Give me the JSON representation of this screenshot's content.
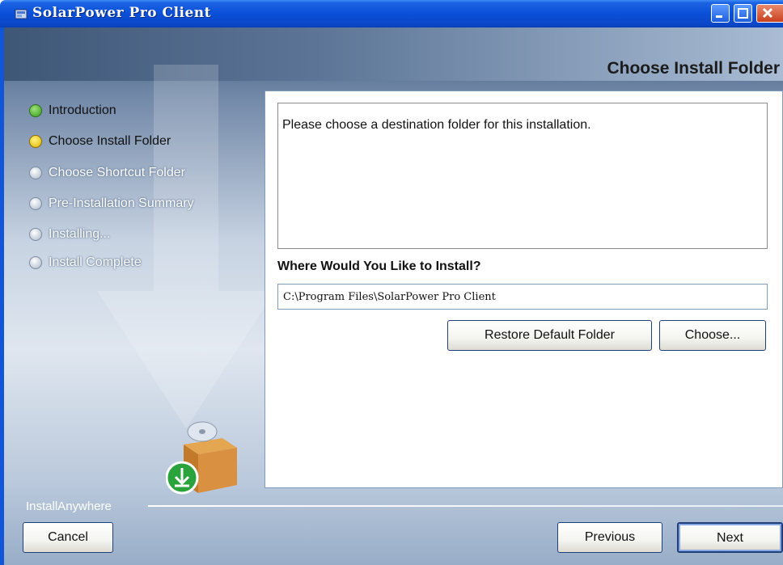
{
  "window": {
    "title": "SolarPower Pro Client",
    "header_title": "Choose Install Folder"
  },
  "steps": [
    {
      "label": "Introduction",
      "status": "done"
    },
    {
      "label": "Choose Install Folder",
      "status": "current"
    },
    {
      "label": "Choose Shortcut Folder",
      "status": "pending"
    },
    {
      "label": "Pre-Installation Summary",
      "status": "pending"
    },
    {
      "label": "Installing...",
      "status": "pending"
    },
    {
      "label": "Install Complete",
      "status": "pending"
    }
  ],
  "content": {
    "message": "Please choose a destination folder for this installation.",
    "where_label": "Where Would You Like to Install?",
    "install_path": "C:\\Program Files\\SolarPower Pro Client",
    "restore_button": "Restore Default Folder",
    "choose_button": "Choose..."
  },
  "footer": {
    "brand": "InstallAnywhere",
    "cancel_button": "Cancel",
    "previous_button": "Previous",
    "next_button": "Next"
  },
  "icons": {
    "title_icon": "installer-icon",
    "product_icon": "box-install-icon",
    "watermark": "down-arrow-icon"
  }
}
